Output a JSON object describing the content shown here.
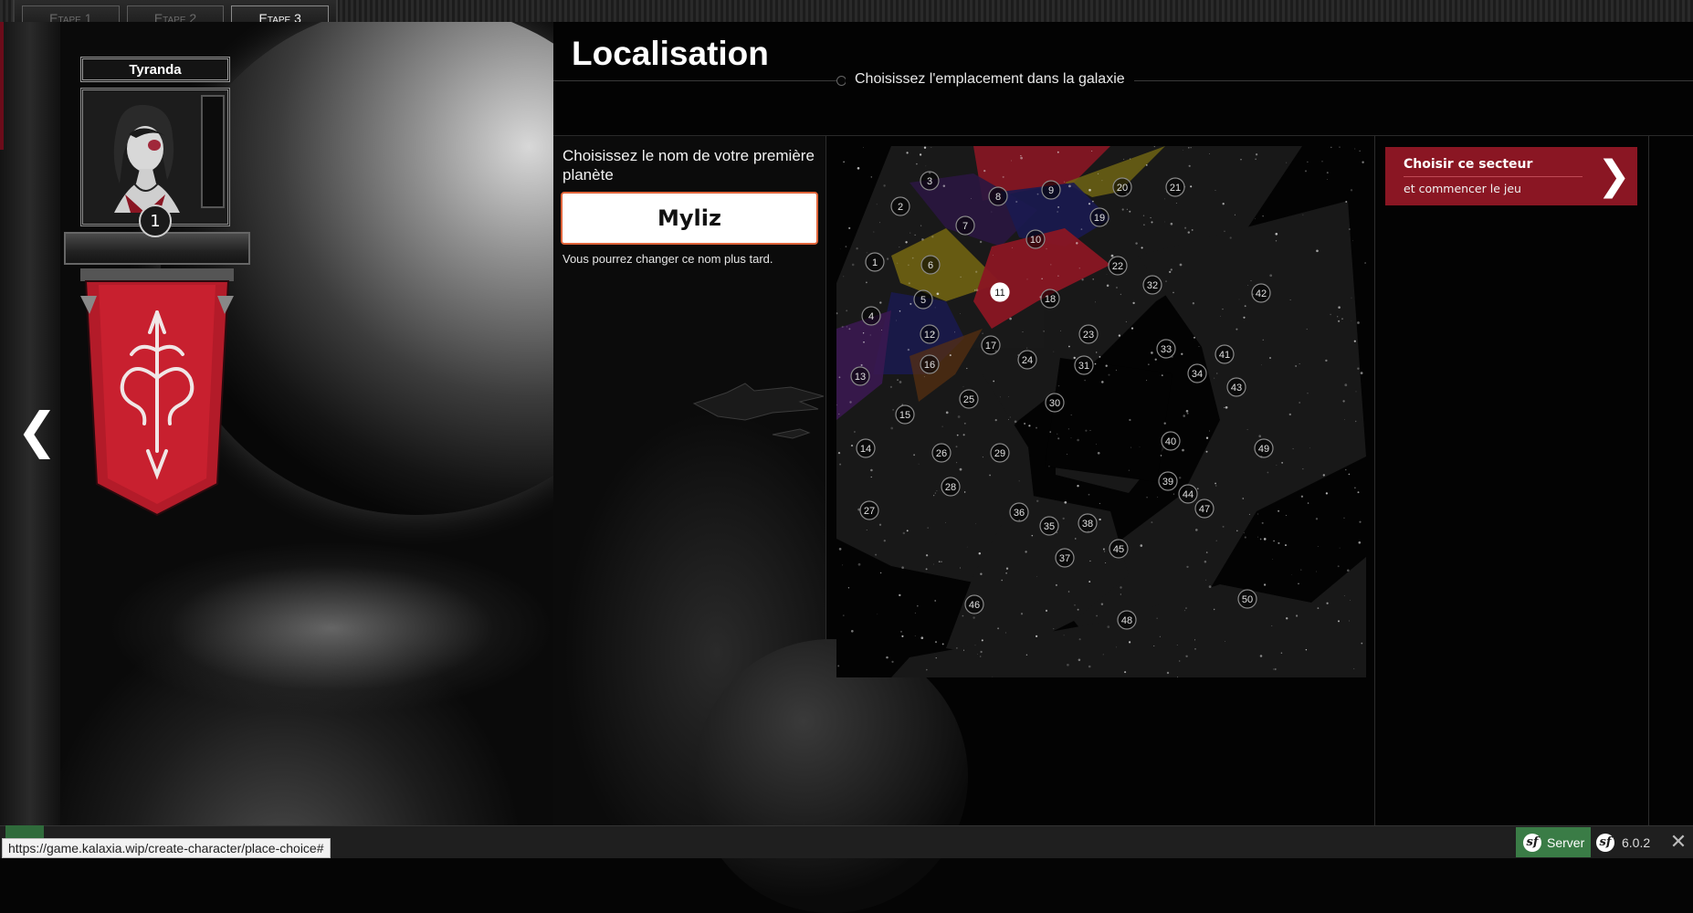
{
  "steps": [
    "Etape 1",
    "Etape 2",
    "Etape 3"
  ],
  "active_step": 3,
  "character": {
    "name": "Tyranda",
    "level": "1"
  },
  "nav": {
    "prev_icon": "chevron-left-icon",
    "next_icon": "chevron-right-icon",
    "prev_glyph": "❮",
    "next_glyph": "❯"
  },
  "page": {
    "title": "Localisation",
    "subtitle": "Choisissez l'emplacement dans la galaxie"
  },
  "planet_form": {
    "label": "Choisissez le nom de votre première planète",
    "value": "Myliz",
    "hint": "Vous pourrez changer ce nom plus tard."
  },
  "galaxy": {
    "selected_sector": 11,
    "sectors": [
      "1",
      "2",
      "3",
      "4",
      "5",
      "6",
      "7",
      "8",
      "9",
      "10",
      "11",
      "12",
      "13",
      "14",
      "15",
      "16",
      "17",
      "18",
      "19",
      "20",
      "21",
      "22",
      "23",
      "24",
      "25",
      "26",
      "27",
      "28",
      "29",
      "30",
      "31",
      "32",
      "33",
      "34",
      "35",
      "36",
      "37",
      "38",
      "39",
      "40",
      "41",
      "42",
      "43",
      "44",
      "45",
      "46",
      "47",
      "48",
      "49",
      "50"
    ]
  },
  "choose_button": {
    "title": "Choisir ce secteur",
    "subtitle": "et commencer le jeu",
    "glyph": "❯"
  },
  "status_bar": {
    "url": "https://game.kalaxia.wip/create-character/place-choice#"
  },
  "debug_toolbar": {
    "server_label": "Server",
    "version": "6.0.2",
    "logo_letter": "sf",
    "close_glyph": "✕"
  },
  "colors": {
    "accent_red": "#8a1623",
    "input_border": "#e0643a",
    "server_green": "#3a7c46"
  }
}
